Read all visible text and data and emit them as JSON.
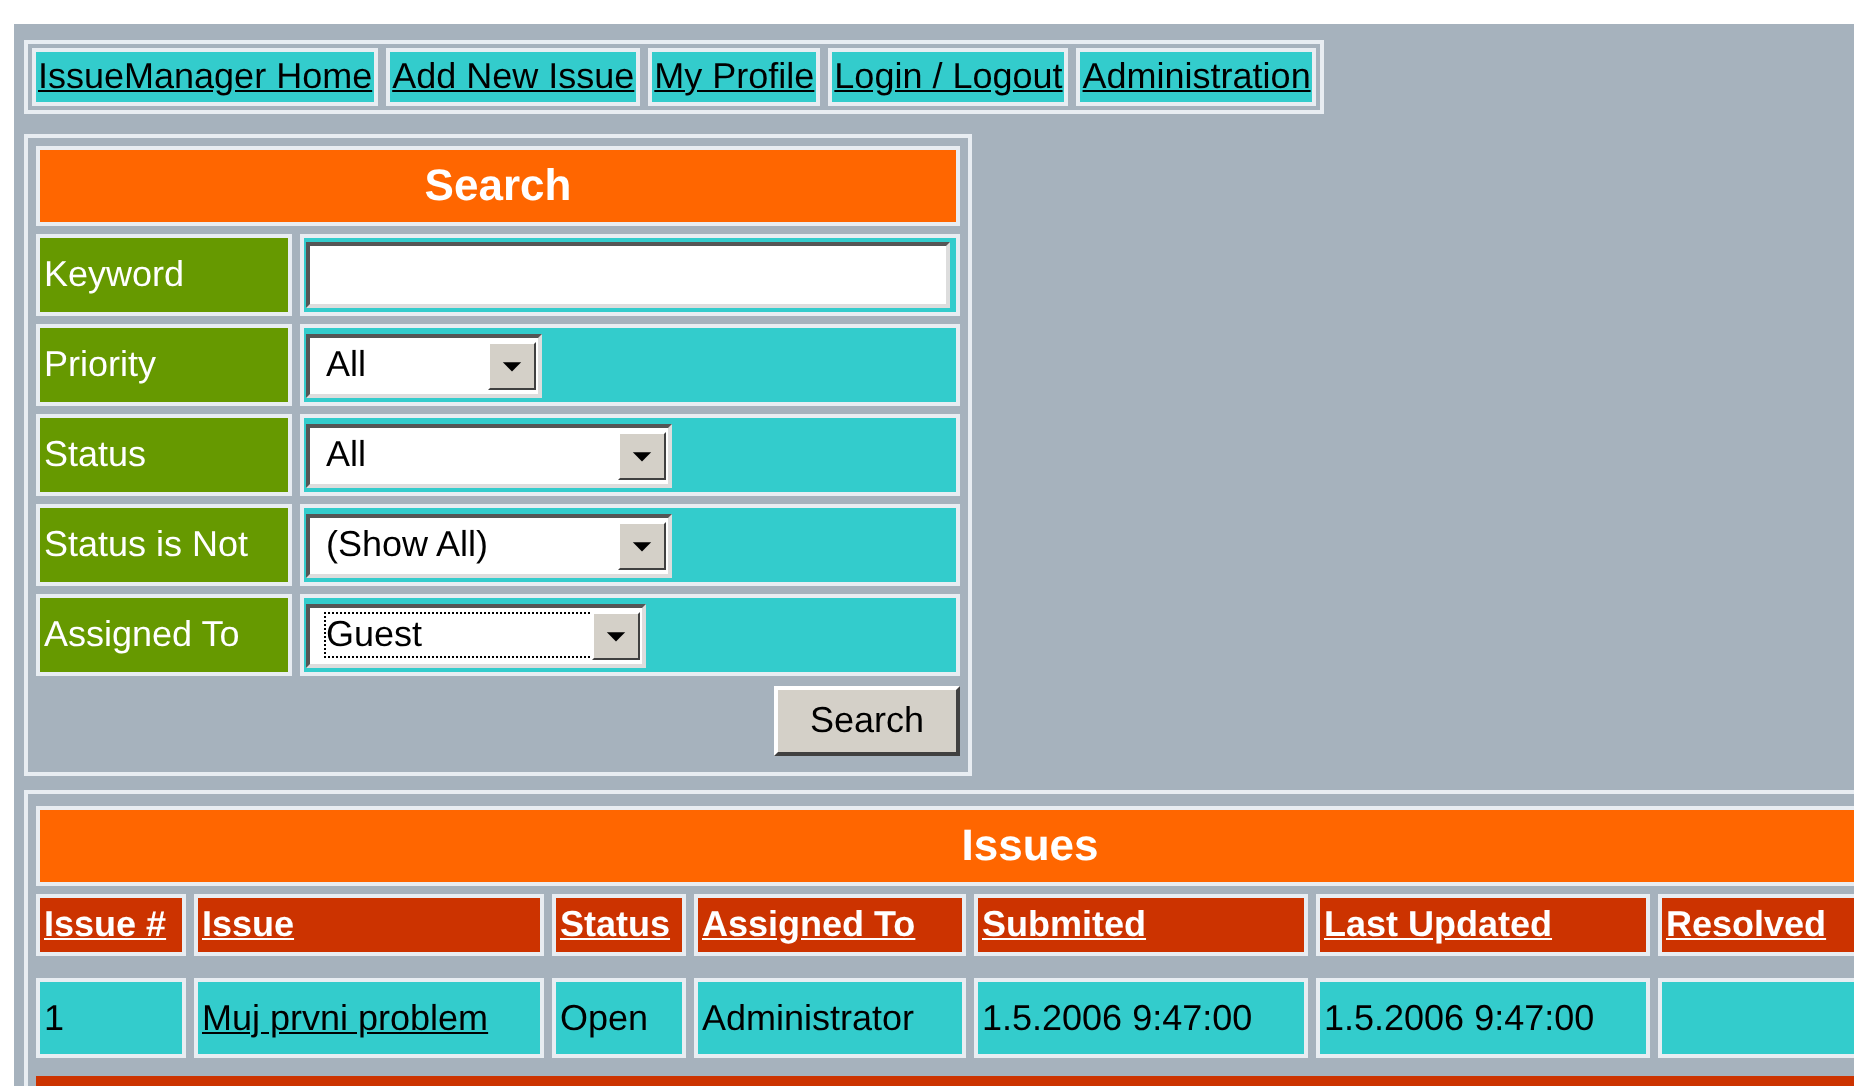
{
  "nav": [
    {
      "label": "IssueManager Home"
    },
    {
      "label": "Add New Issue"
    },
    {
      "label": "My Profile"
    },
    {
      "label": "Login / Logout"
    },
    {
      "label": "Administration"
    }
  ],
  "search": {
    "title": "Search",
    "fields": [
      {
        "label": "Keyword",
        "kind": "text"
      },
      {
        "label": "Priority",
        "kind": "dropdown",
        "value": "All",
        "focused": false
      },
      {
        "label": "Status",
        "kind": "dropdown",
        "value": "All",
        "focused": false
      },
      {
        "label": "Status is Not",
        "kind": "dropdown",
        "value": "(Show All)",
        "focused": false
      },
      {
        "label": "Assigned To",
        "kind": "dropdown",
        "value": "Guest",
        "focused": true
      }
    ],
    "button": "Search"
  },
  "issues": {
    "title": "Issues",
    "columns": [
      "Issue #",
      "Issue",
      "Status",
      "Assigned To",
      "Submited",
      "Last Updated",
      "Resolved"
    ],
    "rows": [
      {
        "cells": [
          {
            "text": "1",
            "link": false
          },
          {
            "text": "Muj prvni problem",
            "link": true
          },
          {
            "text": "Open",
            "link": false
          },
          {
            "text": "Administrator",
            "link": false
          },
          {
            "text": "1.5.2006 9:47:00",
            "link": false
          },
          {
            "text": "1.5.2006 9:47:00",
            "link": false
          }
        ]
      }
    ]
  }
}
